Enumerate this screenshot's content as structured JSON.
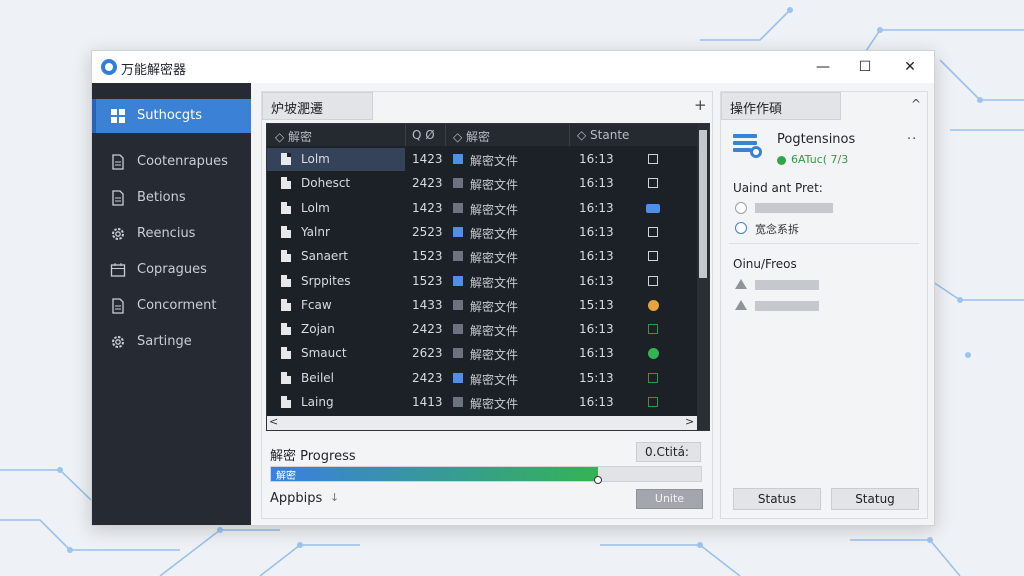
{
  "app": {
    "title": "万能解密器"
  },
  "window_controls": {
    "minimize": "—",
    "maximize": "☐",
    "close": "✕"
  },
  "sidebar": {
    "items": [
      {
        "label": "Suthocgts",
        "icon": "grid-icon",
        "active": true
      },
      {
        "label": "Cootenrapues",
        "icon": "document-icon"
      },
      {
        "label": "Betions",
        "icon": "document-icon"
      },
      {
        "label": "Reencius",
        "icon": "gear-icon"
      },
      {
        "label": "Copragues",
        "icon": "calendar-icon"
      },
      {
        "label": "Concorment",
        "icon": "document-icon"
      },
      {
        "label": "Sartinge",
        "icon": "gear-icon"
      }
    ]
  },
  "main": {
    "tab_label": "炉坡淝遷",
    "add_label": "+",
    "table": {
      "columns": [
        "◇ 解密",
        "Q Ø",
        "◇ 解密",
        "◇ Stante"
      ],
      "rows": [
        {
          "name": "Lolm",
          "size": "1423",
          "type": "解密文件",
          "date": "16:13",
          "type_icon": "blue",
          "state": "empty",
          "selected": true
        },
        {
          "name": "Dohesct",
          "size": "2423",
          "type": "解密文件",
          "date": "16:13",
          "type_icon": "gray",
          "state": "empty"
        },
        {
          "name": "Lolm",
          "size": "1423",
          "type": "解密文件",
          "date": "16:13",
          "type_icon": "gray",
          "state": "blue"
        },
        {
          "name": "Yalnr",
          "size": "2523",
          "type": "解密文件",
          "date": "16:13",
          "type_icon": "blue",
          "state": "empty"
        },
        {
          "name": "Sanaert",
          "size": "1523",
          "type": "解密文件",
          "date": "16:13",
          "type_icon": "gray",
          "state": "empty"
        },
        {
          "name": "Srppites",
          "size": "1523",
          "type": "解密文件",
          "date": "16:13",
          "type_icon": "blue",
          "state": "empty"
        },
        {
          "name": "Fcaw",
          "size": "1433",
          "type": "解密文件",
          "date": "15:13",
          "type_icon": "gray",
          "state": "orange"
        },
        {
          "name": "Zojan",
          "size": "2423",
          "type": "解密文件",
          "date": "16:13",
          "type_icon": "gray",
          "state": "green-empty"
        },
        {
          "name": "Smauct",
          "size": "2623",
          "type": "解密文件",
          "date": "16:13",
          "type_icon": "gray",
          "state": "green"
        },
        {
          "name": "Beilel",
          "size": "2423",
          "type": "解密文件",
          "date": "15:13",
          "type_icon": "blue",
          "state": "green-empty"
        },
        {
          "name": "Laing",
          "size": "1413",
          "type": "解密文件",
          "date": "16:13",
          "type_icon": "gray",
          "state": "green-empty"
        }
      ]
    },
    "scroll": {
      "left": "<",
      "right": ">"
    },
    "progress": {
      "label": "解密 Progress",
      "value_text": "0.Ctitá:",
      "fill_label": "解密",
      "percent": 76
    },
    "apps": {
      "label": "Appbips",
      "arrow": "↓"
    },
    "apply_button": "Unite"
  },
  "right": {
    "tab_label": "操作作碩",
    "collapse": "^",
    "card": {
      "title": "Pogtensinos",
      "status": "6ATuc( 7/3",
      "more": "··"
    },
    "section1": {
      "title": "Uaind ant Pret:",
      "option2": "宽念系拆"
    },
    "section2": {
      "title": "Oinu/Freos"
    },
    "buttons": [
      "Status",
      "Statug"
    ]
  },
  "colors": {
    "accent": "#3b82d6",
    "success": "#34b354",
    "warning": "#e8a33a",
    "sidebar": "#262b33",
    "table": "#1c2027"
  }
}
